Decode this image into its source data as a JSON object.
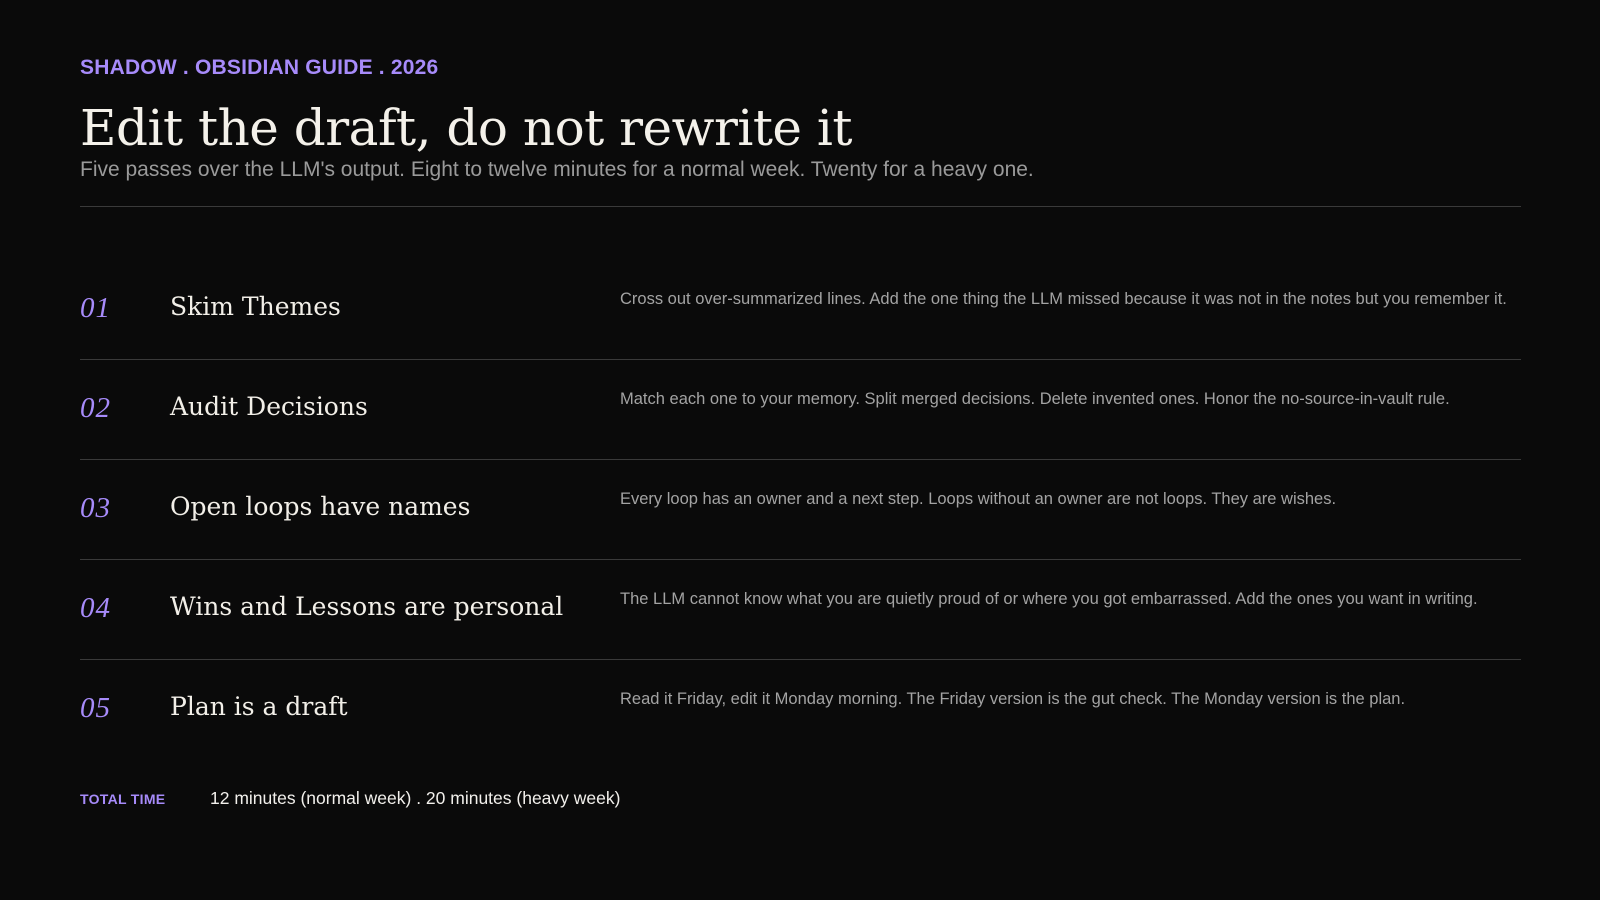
{
  "header": {
    "kicker": "SHADOW . OBSIDIAN GUIDE . 2026",
    "title": "Edit the draft, do not rewrite it",
    "subtitle": "Five passes over the LLM's output. Eight to twelve minutes for a normal week. Twenty for a heavy one."
  },
  "steps": [
    {
      "number": "01",
      "title": "Skim Themes",
      "description": "Cross out over-summarized lines. Add the one thing the LLM missed because it was not in the notes but you remember it."
    },
    {
      "number": "02",
      "title": "Audit Decisions",
      "description": "Match each one to your memory. Split merged decisions. Delete invented ones. Honor the no-source-in-vault rule."
    },
    {
      "number": "03",
      "title": "Open loops have names",
      "description": "Every loop has an owner and a next step. Loops without an owner are not loops. They are wishes."
    },
    {
      "number": "04",
      "title": "Wins and Lessons are personal",
      "description": "The LLM cannot know what you are quietly proud of or where you got embarrassed. Add the ones you want in writing."
    },
    {
      "number": "05",
      "title": "Plan is a draft",
      "description": "Read it Friday, edit it Monday morning. The Friday version is the gut check. The Monday version is the plan."
    }
  ],
  "footer": {
    "total_label": "TOTAL TIME",
    "total_value": "12 minutes (normal week) . 20 minutes (heavy week)"
  },
  "colors": {
    "background": "#0a0a0a",
    "accent": "#a78bfa",
    "text": "#f2f0ec",
    "muted": "#a3a3a3",
    "rule": "#3a3a3a"
  }
}
